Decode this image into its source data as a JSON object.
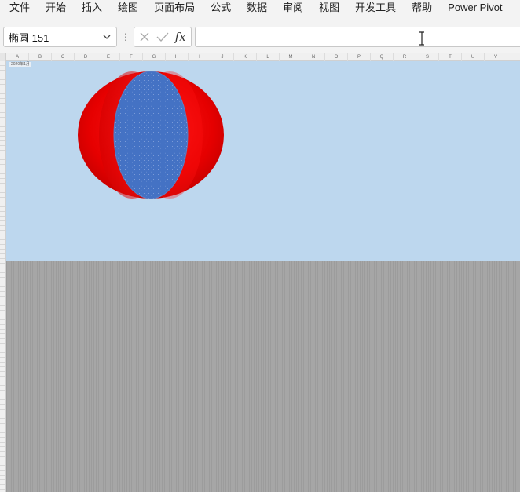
{
  "menu": {
    "items": [
      "文件",
      "开始",
      "插入",
      "绘图",
      "页面布局",
      "公式",
      "数据",
      "审阅",
      "视图",
      "开发工具",
      "帮助",
      "Power Pivot"
    ]
  },
  "formula_bar": {
    "name_box": "椭圆 151",
    "fx_label": "fx",
    "formula_value": ""
  },
  "sheet": {
    "columns": [
      "A",
      "B",
      "C",
      "D",
      "E",
      "F",
      "G",
      "H",
      "I",
      "J",
      "K",
      "L",
      "M",
      "N",
      "O",
      "P",
      "Q",
      "R",
      "S",
      "T",
      "U",
      "V"
    ],
    "cell_label": "2020年1月",
    "colors": {
      "top_fill": "#bdd7ee",
      "bottom_fill": "#a6a6a6",
      "ball_red": "#e00000",
      "ball_blue": "#4472c4"
    }
  }
}
